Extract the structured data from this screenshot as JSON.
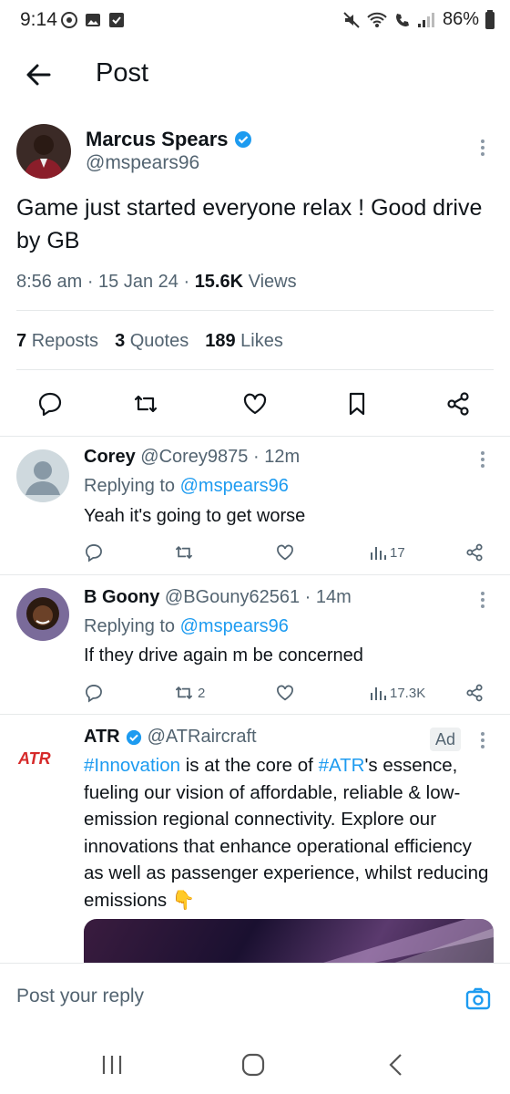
{
  "status_bar": {
    "time": "9:14",
    "battery": "86%"
  },
  "header": {
    "title": "Post"
  },
  "tweet": {
    "author_name": "Marcus Spears",
    "handle": "@mspears96",
    "text": "Game just started everyone relax ! Good drive by GB",
    "time": "8:56 am",
    "date": "15 Jan 24",
    "views_count": "15.6K",
    "views_label": "Views",
    "reposts_count": "7",
    "reposts_label": "Reposts",
    "quotes_count": "3",
    "quotes_label": "Quotes",
    "likes_count": "189",
    "likes_label": "Likes"
  },
  "replies": [
    {
      "name": "Corey",
      "handle": "@Corey9875",
      "time": "12m",
      "replying_prefix": "Replying to",
      "replying_to": "@mspears96",
      "text": "Yeah it's going to get worse",
      "reposts": "",
      "views": "17"
    },
    {
      "name": "B Goony",
      "handle": "@BGouny62561",
      "time": "14m",
      "replying_prefix": "Replying to",
      "replying_to": "@mspears96",
      "text": "If they drive again m be concerned",
      "reposts": "2",
      "views": "17.3K"
    }
  ],
  "ad": {
    "name": "ATR",
    "handle": "@ATRaircraft",
    "badge": "Ad",
    "logo_text": "ATR",
    "hashtag1": "#Innovation",
    "text1": " is at the core of ",
    "hashtag2": "#ATR",
    "text2": "'s essence, fueling our vision of affordable, reliable & low-emission regional connectivity. Explore our innovations that enhance operational efficiency as well as passenger experience, whilst reducing emissions 👇"
  },
  "reply_bar": {
    "placeholder": "Post your reply"
  },
  "colors": {
    "accent": "#1d9bf0",
    "text": "#0f1419",
    "secondary": "#536471"
  }
}
